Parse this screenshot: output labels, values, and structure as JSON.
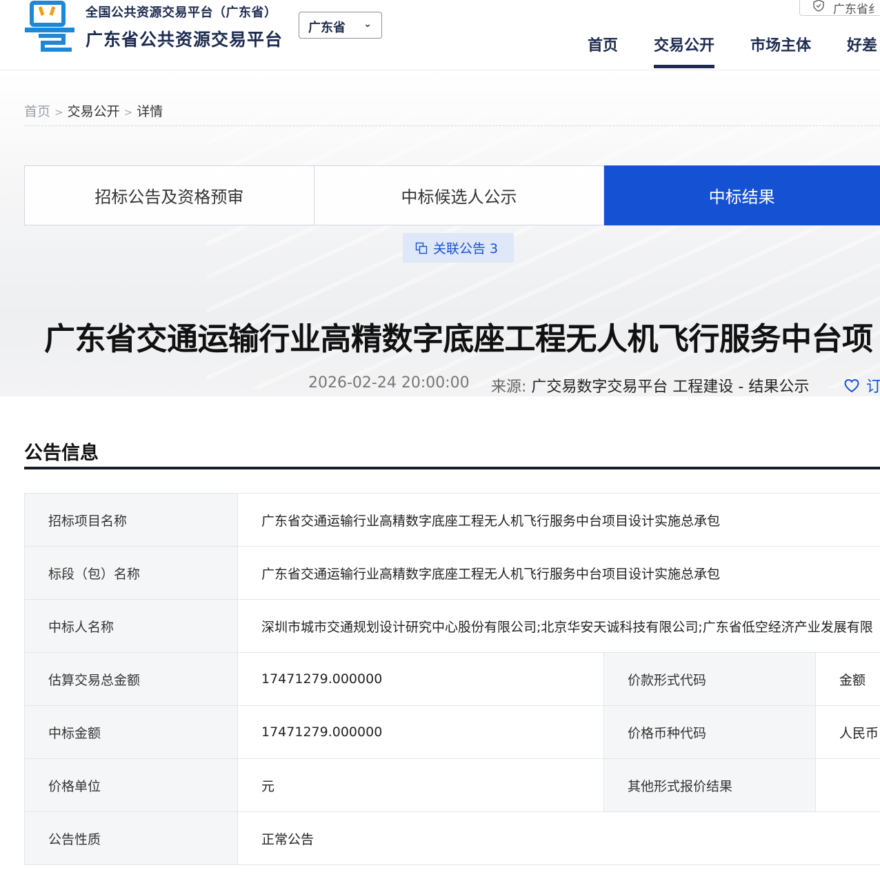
{
  "header": {
    "platform_line1": "全国公共资源交易平台（广东省）",
    "platform_line2": "广东省公共资源交易平台",
    "region_select": "广东省",
    "top_right_badge": "广东省纟",
    "nav": [
      "首页",
      "交易公开",
      "市场主体",
      "好差"
    ]
  },
  "breadcrumb": [
    "首页",
    "交易公开",
    "详情"
  ],
  "tabs": [
    "招标公告及资格预审",
    "中标候选人公示",
    "中标结果"
  ],
  "related_button": "关联公告 3",
  "title": "广东省交通运输行业高精数字底座工程无人机飞行服务中台项",
  "meta": {
    "date": "2026-02-24 20:00:00",
    "source_label": "来源:",
    "source_value": "广交易数字交易平台 工程建设 - 结果公示",
    "favorite": "订"
  },
  "section_title": "公告信息",
  "info": {
    "project_name_label": "招标项目名称",
    "project_name": "广东省交通运输行业高精数字底座工程无人机飞行服务中台项目设计实施总承包",
    "section_name_label": "标段（包）名称",
    "section_name": "广东省交通运输行业高精数字底座工程无人机飞行服务中台项目设计实施总承包",
    "winner_label": "中标人名称",
    "winner": "深圳市城市交通规划设计研究中心股份有限公司;北京华安天诚科技有限公司;广东省低空经济产业发展有限",
    "estimated_total_label": "估算交易总金额",
    "estimated_total": "17471279.000000",
    "price_form_code_label": "价款形式代码",
    "price_form_code": "金额",
    "winning_amount_label": "中标金额",
    "winning_amount": "17471279.000000",
    "currency_code_label": "价格币种代码",
    "currency_code": "人民币",
    "price_unit_label": "价格单位",
    "price_unit": "元",
    "other_quote_label": "其他形式报价结果",
    "other_quote": "",
    "notice_nature_label": "公告性质",
    "notice_nature": "正常公告"
  },
  "colors": {
    "brand_navy": "#1d2b4f",
    "accent_blue": "#1551d3",
    "logo_blue": "#1e88d6"
  }
}
